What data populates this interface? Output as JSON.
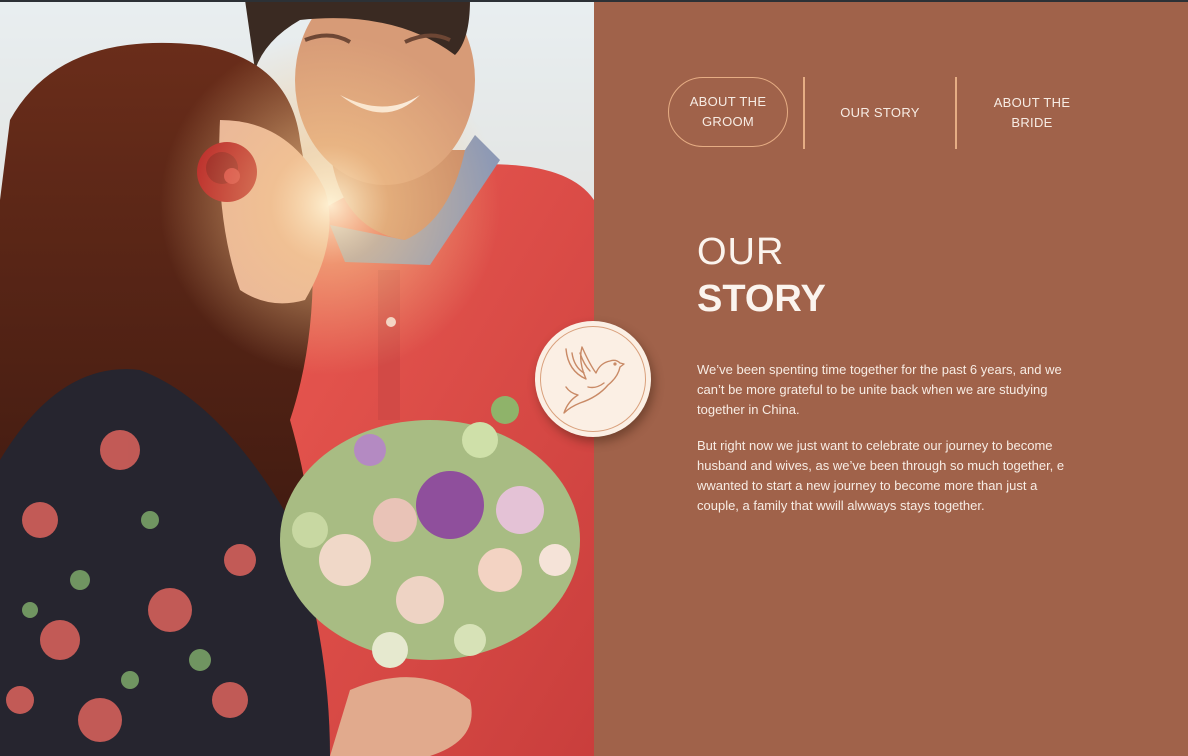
{
  "nav": {
    "tabs": [
      {
        "label": "ABOUT THE GROOM",
        "line1": "ABOUT THE",
        "line2": "GROOM"
      },
      {
        "label": "OUR STORY"
      },
      {
        "label": "ABOUT THE BRIDE",
        "line1": "ABOUT THE",
        "line2": "BRIDE"
      }
    ]
  },
  "heading": {
    "line1": "OUR",
    "line2": "STORY"
  },
  "body": {
    "paragraph1": "We’ve been spenting time together for the past 6 years, and we can’t be more grateful to be unite back when we are studying together in China.",
    "paragraph2": "But right now we just want to celebrate our journey to become husband and wives, as we’ve been through so much together, e wwanted to start a new journey to become more than just a couple, a family that wwill alwways stays together."
  },
  "icons": {
    "badge": "dove-icon"
  },
  "colors": {
    "panel": "#a0624a",
    "accent": "#e6ad84",
    "text": "#f7ece4",
    "badge": "#fbefe4"
  }
}
